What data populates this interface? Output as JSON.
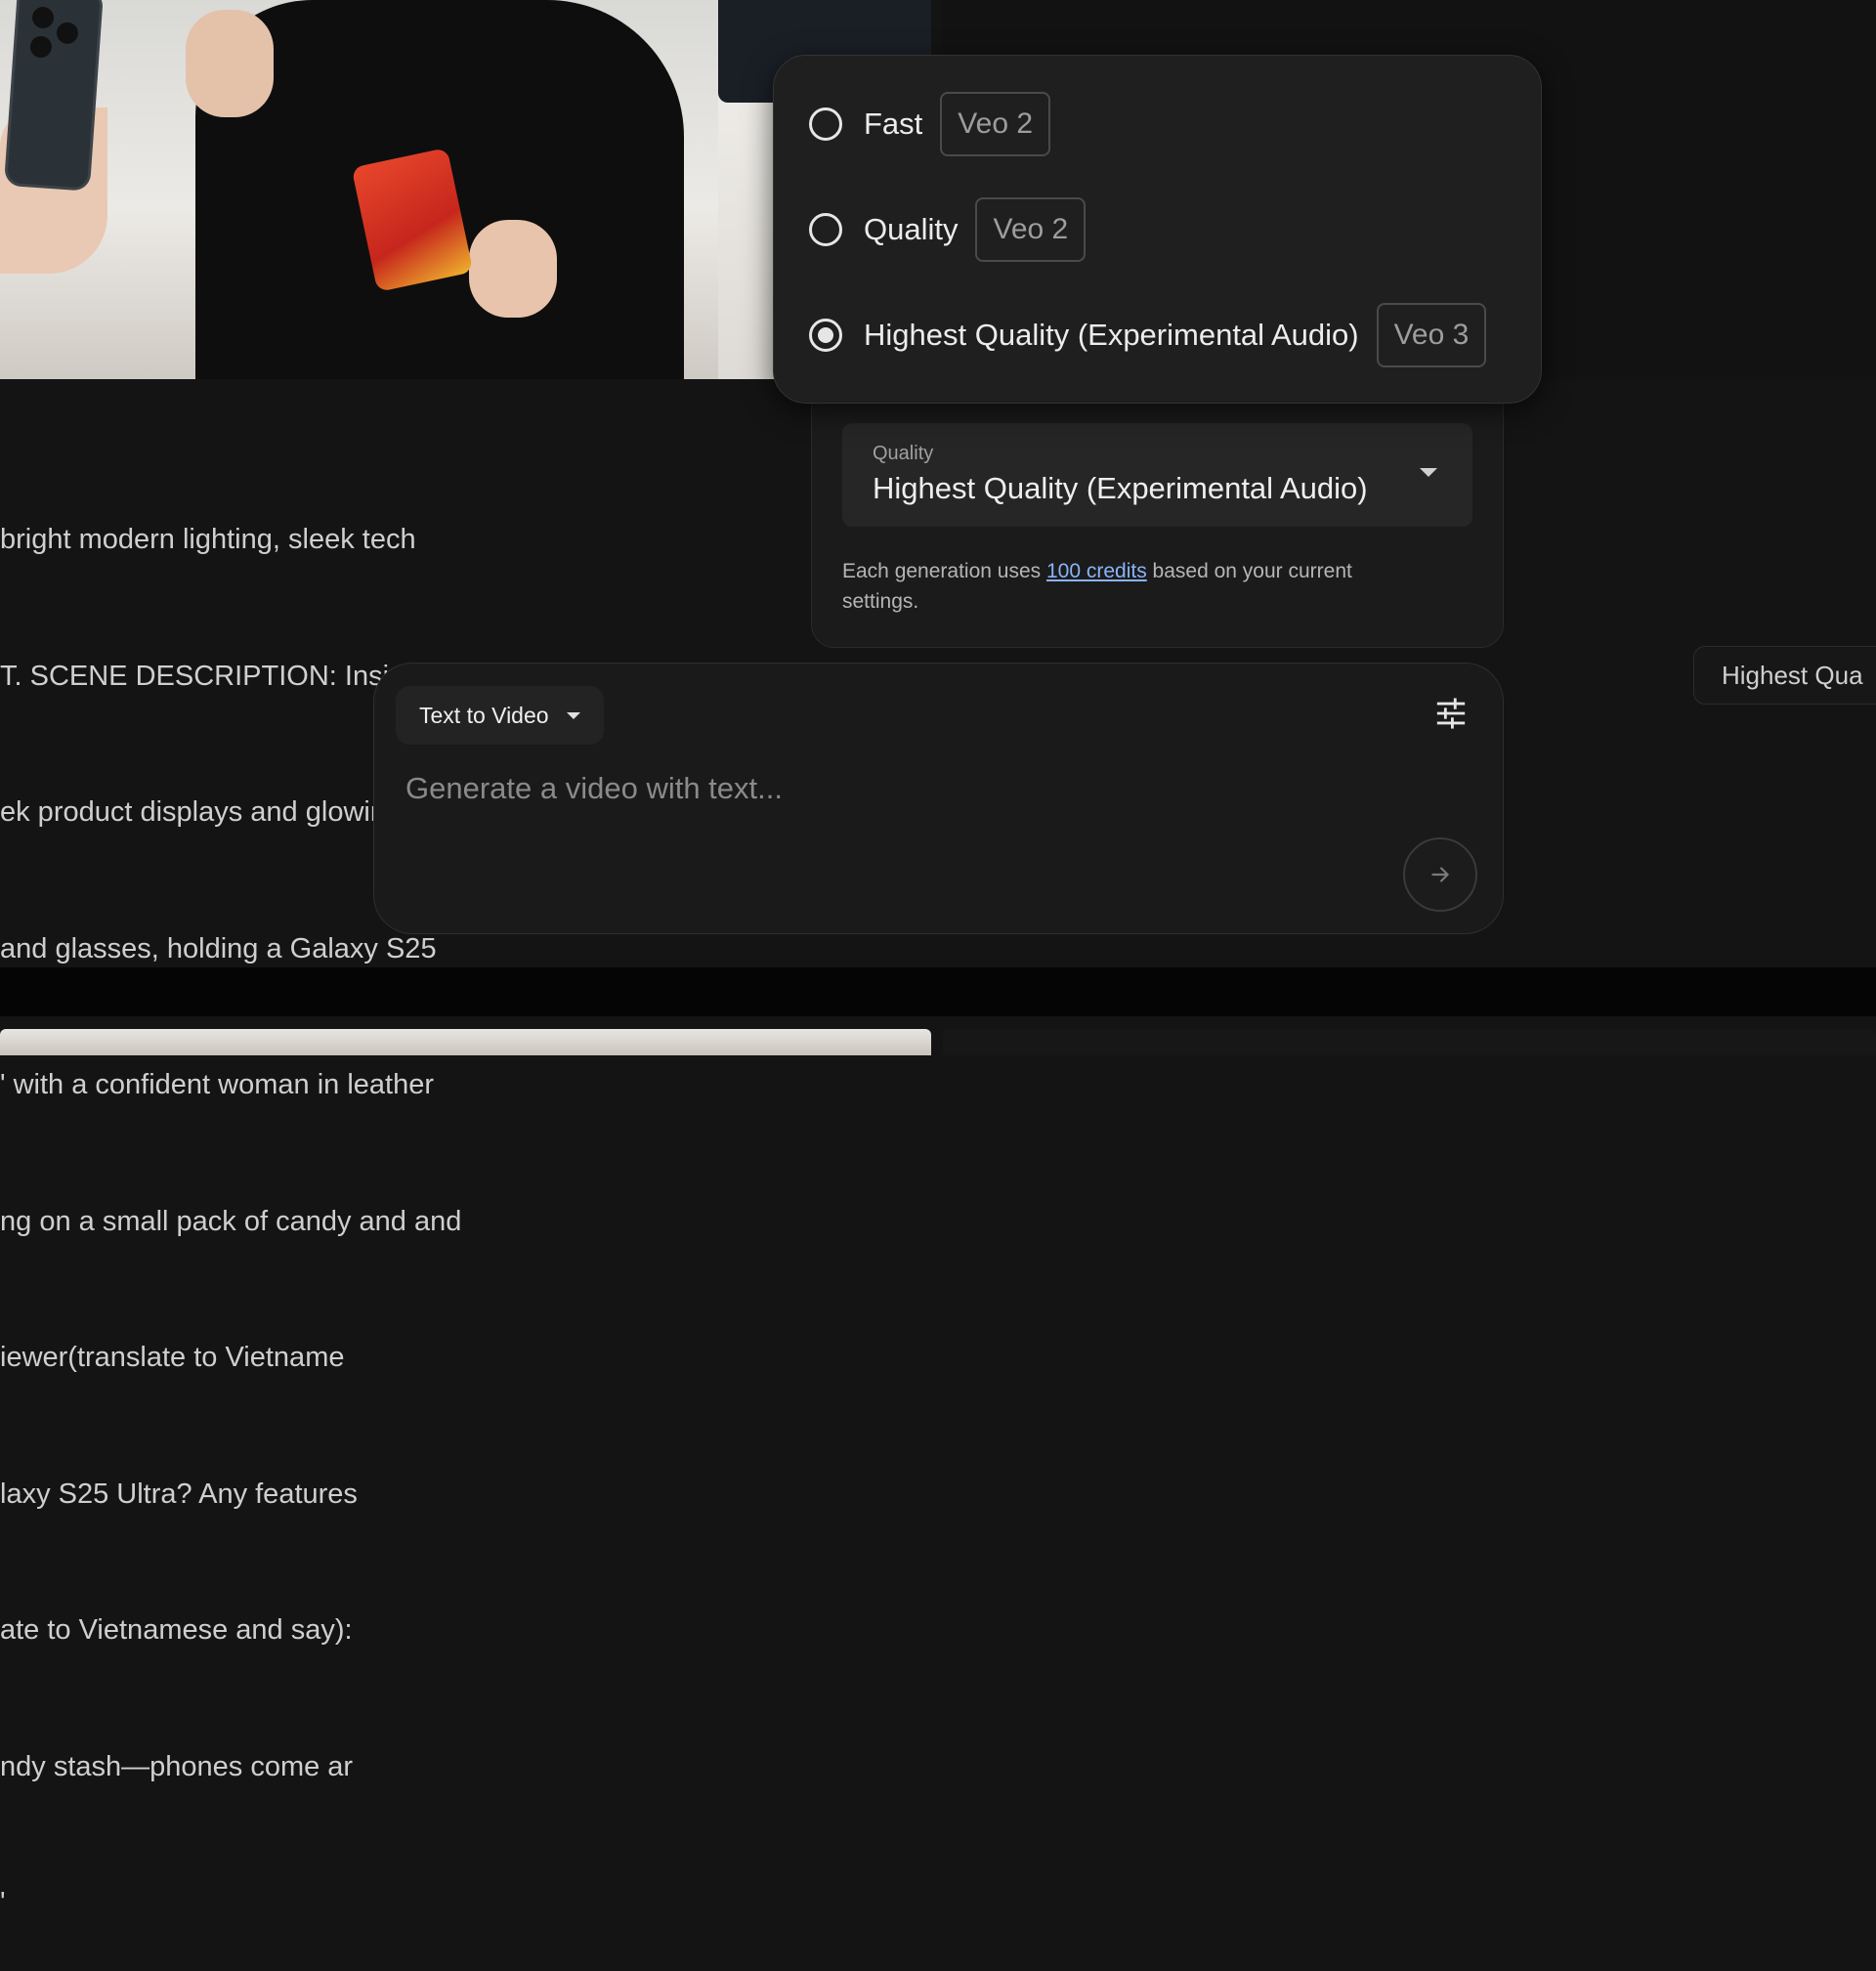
{
  "background": {
    "prompt_lines": [
      "bright modern lighting, sleek tech",
      "T. SCENE DESCRIPTION: Inside a",
      "ek product displays and glowing",
      "and glasses, holding a Galaxy S25",
      "' with a confident woman in leather",
      "ng on a small pack of candy and and",
      "iewer(translate to Vietname",
      "laxy S25 Ultra? Any features",
      "ate to Vietnamese and say):",
      "ndy stash—phones come ar",
      "'"
    ],
    "right_chip_label": "Highest Qua"
  },
  "quality_menu": {
    "options": [
      {
        "label": "Fast",
        "badge": "Veo 2",
        "selected": false
      },
      {
        "label": "Quality",
        "badge": "Veo 2",
        "selected": false
      },
      {
        "label": "Highest Quality (Experimental Audio)",
        "badge": "Veo 3",
        "selected": true
      }
    ]
  },
  "settings": {
    "quality_label": "Quality",
    "quality_value": "Highest Quality (Experimental Audio)",
    "credits_prefix": "Each generation uses ",
    "credits_link": "100 credits",
    "credits_suffix": " based on your current settings."
  },
  "composer": {
    "mode_label": "Text to Video",
    "placeholder": "Generate a video with text..."
  },
  "icons": {
    "tune": "tune-icon",
    "send": "arrow-right-icon",
    "caret": "chevron-down-icon"
  }
}
